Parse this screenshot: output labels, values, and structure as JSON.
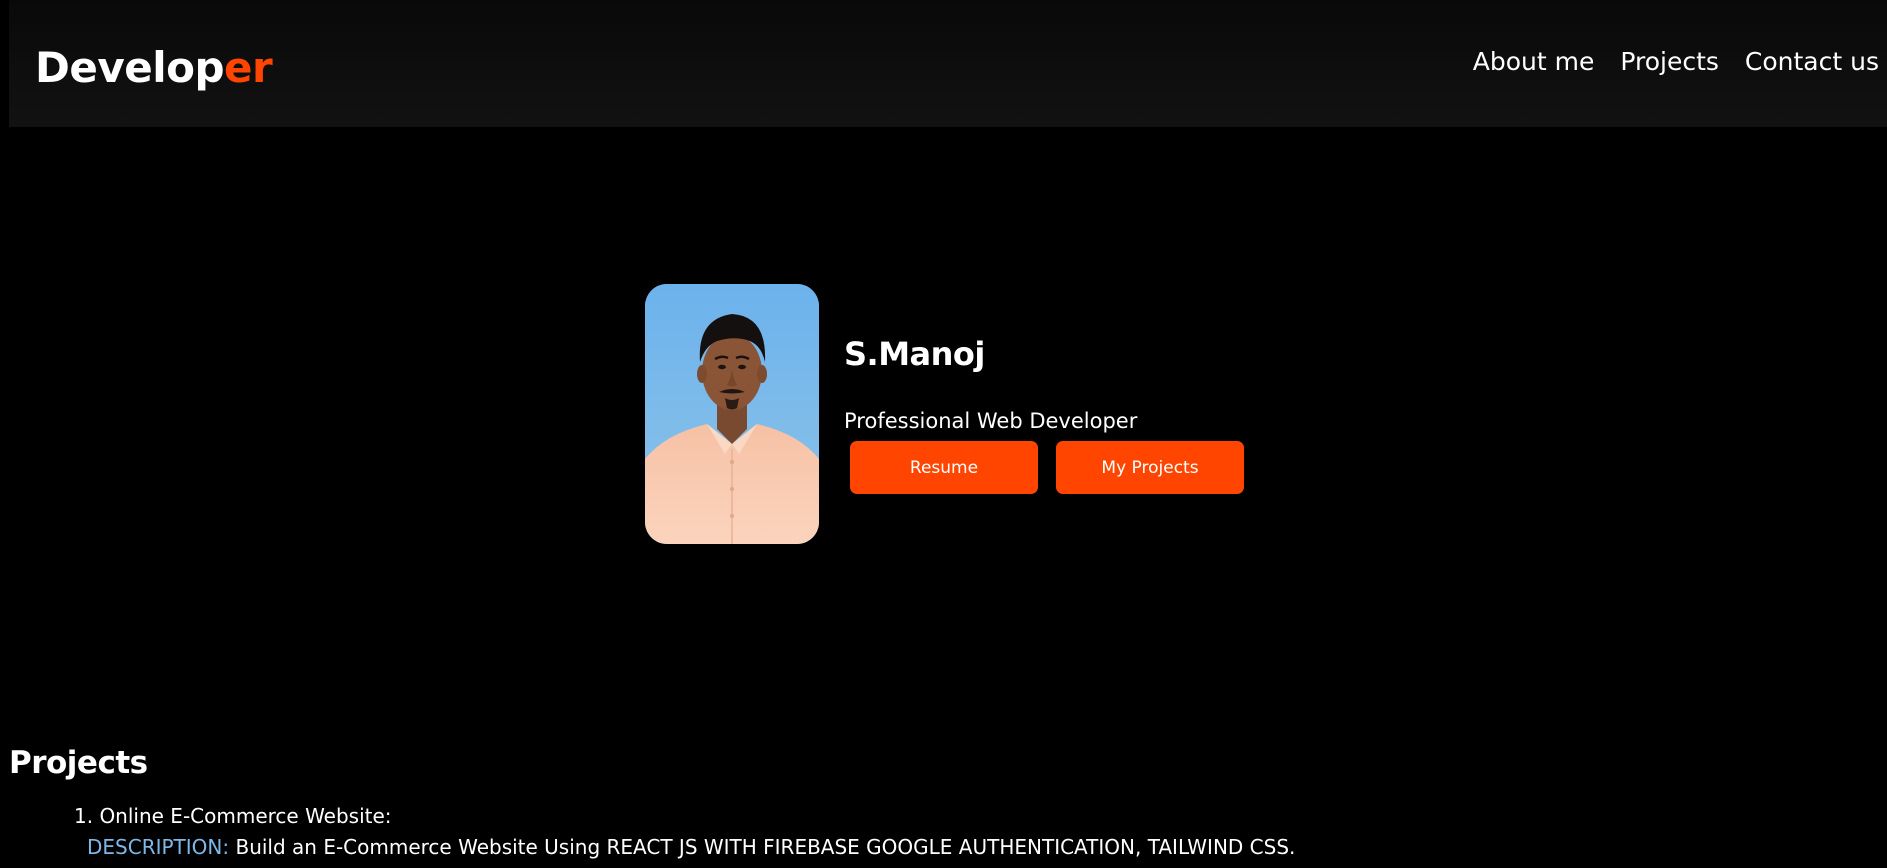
{
  "header": {
    "logo_main": "Develop",
    "logo_accent": "er",
    "nav": [
      {
        "label": "About me"
      },
      {
        "label": "Projects"
      },
      {
        "label": "Contact us"
      }
    ]
  },
  "hero": {
    "name": "S.Manoj",
    "role": "Professional Web Developer",
    "buttons": {
      "resume": "Resume",
      "projects": "My Projects"
    }
  },
  "projects": {
    "title": "Projects",
    "items": [
      {
        "title": "1. Online E-Commerce Website:",
        "desc_label": "DESCRIPTION:",
        "desc_text": " Build an E-Commerce Website Using REACT JS WITH FIREBASE GOOGLE AUTHENTICATION, TAILWIND CSS."
      }
    ]
  },
  "colors": {
    "accent": "#ff4500",
    "background": "#000000",
    "navbar": "#0d0d0d",
    "description_label": "#7fb8e8"
  }
}
